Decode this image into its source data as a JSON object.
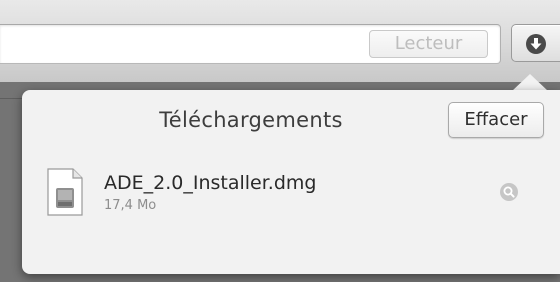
{
  "toolbar": {
    "reader_label": "Lecteur",
    "downloads_icon": "download-arrow-icon"
  },
  "downloads_popover": {
    "title": "Téléchargements",
    "clear_label": "Effacer",
    "items": [
      {
        "name": "ADE_2.0_Installer.dmg",
        "size": "17,4 Mo",
        "icon": "disk-image-file-icon",
        "action_icon": "magnifier-icon"
      }
    ]
  }
}
